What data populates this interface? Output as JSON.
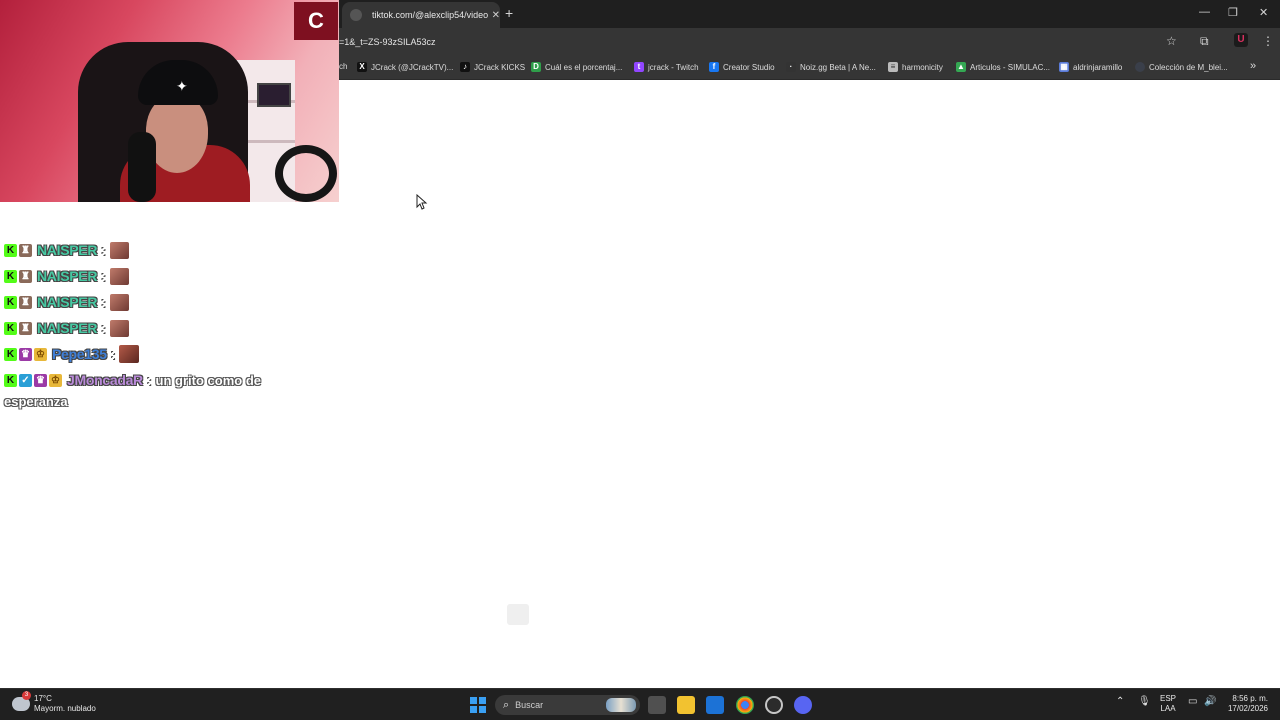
{
  "browser": {
    "tab_title": "tiktok.com/@alexclip54/video/",
    "tab_close": "✕",
    "new_tab": "+",
    "window_controls": {
      "minimize": "—",
      "maximize": "❐",
      "close": "✕"
    },
    "url": "=1&_t=ZS-93zSILA53cz",
    "bookmarks": [
      {
        "label": "ch",
        "icon": "page-icon",
        "color": "#555555"
      },
      {
        "label": "JCrack (@JCrackTV)...",
        "icon": "x-icon",
        "color": "#111111"
      },
      {
        "label": "JCrack KICKS",
        "icon": "tiktok-icon",
        "color": "#111111"
      },
      {
        "label": "Cuál es el porcentaj...",
        "icon": "d-icon",
        "color": "#2f9e4a"
      },
      {
        "label": "jcrack - Twitch",
        "icon": "twitch-icon",
        "color": "#9146ff"
      },
      {
        "label": "Creator Studio",
        "icon": "facebook-icon",
        "color": "#1877f2"
      },
      {
        "label": "Noiz.gg Beta | A Ne...",
        "icon": "noiz-icon",
        "color": "#333333"
      },
      {
        "label": "harmonicity",
        "icon": "doc-icon",
        "color": "#bbbbbb"
      },
      {
        "label": "Articulos - SIMULAC...",
        "icon": "drive-icon",
        "color": "#34a853"
      },
      {
        "label": "aldrinjaramillo",
        "icon": "site-icon",
        "color": "#5a7bd8"
      },
      {
        "label": "Colección de M_blei...",
        "icon": "circle-icon",
        "color": "#3a3f4a"
      }
    ],
    "more_bookmarks": "»"
  },
  "overlay": {
    "logo_letter": "C"
  },
  "chat": {
    "messages": [
      {
        "badges": [
          "kick",
          "mod"
        ],
        "user": "NAISPER",
        "user_color": "#47c9a3",
        "colon": ":",
        "emote": true
      },
      {
        "badges": [
          "kick",
          "mod"
        ],
        "user": "NAISPER",
        "user_color": "#47c9a3",
        "colon": ":",
        "emote": true
      },
      {
        "badges": [
          "kick",
          "mod"
        ],
        "user": "NAISPER",
        "user_color": "#47c9a3",
        "colon": ":",
        "emote": true
      },
      {
        "badges": [
          "kick",
          "mod"
        ],
        "user": "NAISPER",
        "user_color": "#47c9a3",
        "colon": ":",
        "emote": true
      },
      {
        "badges": [
          "kick",
          "sub",
          "crown"
        ],
        "user": "Pepe135",
        "user_color": "#3f7fd8",
        "colon": ":",
        "emote": true
      },
      {
        "badges": [
          "kick",
          "blue",
          "sub",
          "crown"
        ],
        "user": "JMoncadaR",
        "user_color": "#b98ad8",
        "colon": ":",
        "text_line1": "un grito como de",
        "text_line2": "esperanza"
      }
    ]
  },
  "taskbar": {
    "weather_temp": "17°C",
    "weather_desc": "Mayorm. nublado",
    "weather_badge": "3",
    "search_placeholder": "Buscar",
    "lang_top": "ESP",
    "lang_bottom": "LAA",
    "time": "8:56 p. m.",
    "date": "17/02/2026"
  }
}
